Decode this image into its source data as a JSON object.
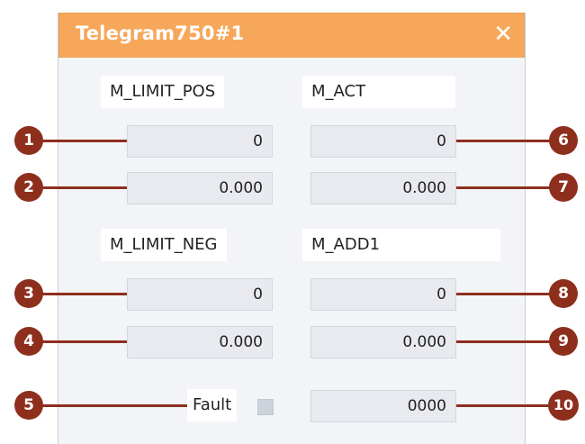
{
  "window": {
    "title": "Telegram750#1",
    "close_icon": "close-icon"
  },
  "labels": {
    "m_limit_pos": "M_LIMIT_POS",
    "m_act": "M_ACT",
    "m_limit_neg": "M_LIMIT_NEG",
    "m_add1": "M_ADD1",
    "fault": "Fault"
  },
  "fields": {
    "limit_pos_int": "0",
    "limit_pos_real": "0.000",
    "act_int": "0",
    "act_real": "0.000",
    "limit_neg_int": "0",
    "limit_neg_real": "0.000",
    "add1_int": "0",
    "add1_real": "0.000",
    "bottom_hex": "0000"
  },
  "callouts": [
    "1",
    "2",
    "3",
    "4",
    "5",
    "6",
    "7",
    "8",
    "9",
    "10"
  ],
  "colors": {
    "title_bar": "#f7a75a",
    "callout": "#8e2f1e",
    "panel": "#f2f4f8",
    "field": "#e8eaef"
  }
}
